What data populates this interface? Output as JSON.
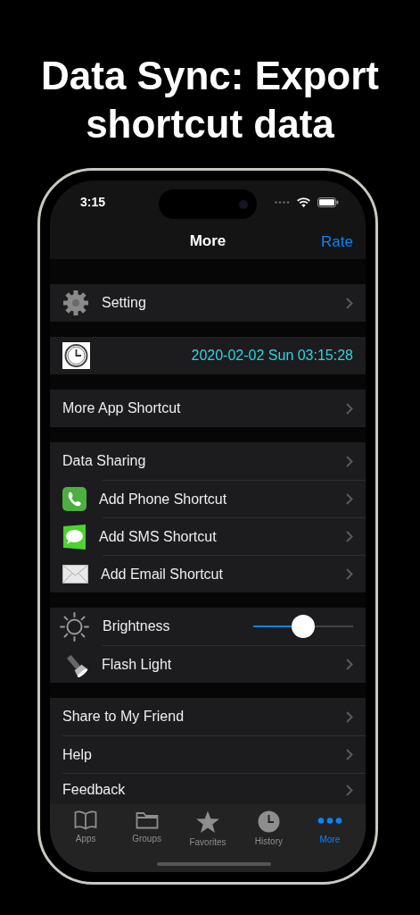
{
  "headline": [
    "Data Sync: Export",
    "shortcut data"
  ],
  "status_bar": {
    "time": "3:15"
  },
  "nav_bar": {
    "title": "More",
    "right_button": "Rate"
  },
  "sections": [
    [
      {
        "kind": "link",
        "label": "Setting"
      }
    ],
    [
      {
        "kind": "clock",
        "value": "2020-02-02 Sun 03:15:28"
      }
    ],
    [
      {
        "kind": "link",
        "label": "More App Shortcut"
      }
    ],
    [
      {
        "kind": "link",
        "label": "Data Sharing"
      },
      {
        "kind": "link",
        "label": "Add Phone Shortcut"
      },
      {
        "kind": "link",
        "label": "Add SMS Shortcut"
      },
      {
        "kind": "link",
        "label": "Add Email Shortcut"
      }
    ],
    [
      {
        "kind": "slider",
        "label": "Brightness",
        "level": 0.5
      },
      {
        "kind": "link",
        "label": "Flash Light"
      }
    ],
    [
      {
        "kind": "link",
        "label": "Share to My Friend"
      },
      {
        "kind": "link",
        "label": "Help"
      },
      {
        "kind": "link",
        "label": "Feedback"
      }
    ]
  ],
  "tabs": [
    {
      "label": "Apps",
      "selected": false
    },
    {
      "label": "Groups",
      "selected": false
    },
    {
      "label": "Favorites",
      "selected": false
    },
    {
      "label": "History",
      "selected": false
    },
    {
      "label": "More",
      "selected": true
    }
  ]
}
